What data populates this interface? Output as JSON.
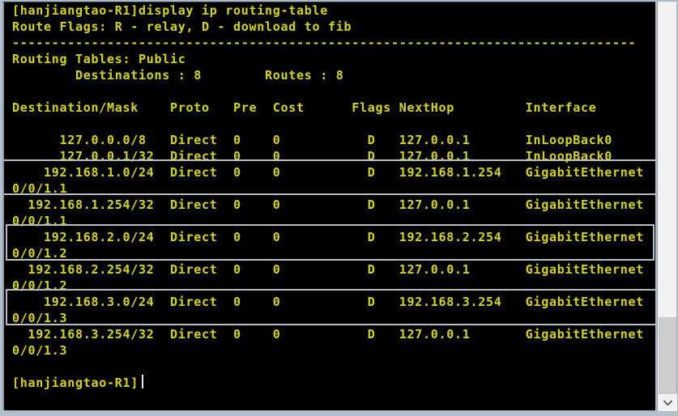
{
  "window": {
    "title": "display ip routing-table",
    "background_color": "#b3bfcb",
    "console_background": "#000000",
    "text_color": "#cccc33",
    "highlight_border_color": "#b9bcc0"
  },
  "console": {
    "prompt": "[hanjiangtao-R1]",
    "command": "display ip routing-table",
    "lines": [
      "[hanjiangtao-R1]display ip routing-table",
      "Route Flags: R - relay, D - download to fib",
      "-------------------------------------------------------------------------------",
      "Routing Tables: Public",
      "        Destinations : 8        Routes : 8",
      "",
      "Destination/Mask    Proto   Pre  Cost      Flags NextHop         Interface",
      "",
      "      127.0.0.0/8   Direct  0    0           D   127.0.0.1       InLoopBack0",
      "      127.0.0.1/32  Direct  0    0           D   127.0.0.1       InLoopBack0",
      "    192.168.1.0/24  Direct  0    0           D   192.168.1.254   GigabitEthernet",
      "0/0/1.1",
      "  192.168.1.254/32  Direct  0    0           D   127.0.0.1       GigabitEthernet",
      "0/0/1.1",
      "    192.168.2.0/24  Direct  0    0           D   192.168.2.254   GigabitEthernet",
      "0/0/1.2",
      "  192.168.2.254/32  Direct  0    0           D   127.0.0.1       GigabitEthernet",
      "0/0/1.2",
      "    192.168.3.0/24  Direct  0    0           D   192.168.3.254   GigabitEthernet",
      "0/0/1.3",
      "  192.168.3.254/32  Direct  0    0           D   127.0.0.1       GigabitEthernet",
      "0/0/1.3",
      "",
      "[hanjiangtao-R1]"
    ],
    "route_flags_legend": "Route Flags: R - relay, D - download to fib",
    "separator": "-------------------------------------------------------------------------------",
    "routing_table_name": "Routing Tables: Public",
    "destinations_label": "Destinations :",
    "destinations_count": "8",
    "routes_label": "Routes :",
    "routes_count": "8",
    "columns": [
      "Destination/Mask",
      "Proto",
      "Pre",
      "Cost",
      "Flags",
      "NextHop",
      "Interface"
    ],
    "routes": [
      {
        "destination": "127.0.0.0/8",
        "proto": "Direct",
        "pre": "0",
        "cost": "0",
        "flags": "D",
        "nexthop": "127.0.0.1",
        "interface": "InLoopBack0",
        "highlighted": false
      },
      {
        "destination": "127.0.0.1/32",
        "proto": "Direct",
        "pre": "0",
        "cost": "0",
        "flags": "D",
        "nexthop": "127.0.0.1",
        "interface": "InLoopBack0",
        "highlighted": false
      },
      {
        "destination": "192.168.1.0/24",
        "proto": "Direct",
        "pre": "0",
        "cost": "0",
        "flags": "D",
        "nexthop": "192.168.1.254",
        "interface": "GigabitEthernet0/0/1.1",
        "highlighted": true
      },
      {
        "destination": "192.168.1.254/32",
        "proto": "Direct",
        "pre": "0",
        "cost": "0",
        "flags": "D",
        "nexthop": "127.0.0.1",
        "interface": "GigabitEthernet0/0/1.1",
        "highlighted": false
      },
      {
        "destination": "192.168.2.0/24",
        "proto": "Direct",
        "pre": "0",
        "cost": "0",
        "flags": "D",
        "nexthop": "192.168.2.254",
        "interface": "GigabitEthernet0/0/1.2",
        "highlighted": true
      },
      {
        "destination": "192.168.2.254/32",
        "proto": "Direct",
        "pre": "0",
        "cost": "0",
        "flags": "D",
        "nexthop": "127.0.0.1",
        "interface": "GigabitEthernet0/0/1.2",
        "highlighted": false
      },
      {
        "destination": "192.168.3.0/24",
        "proto": "Direct",
        "pre": "0",
        "cost": "0",
        "flags": "D",
        "nexthop": "192.168.3.254",
        "interface": "GigabitEthernet0/0/1.3",
        "highlighted": true
      },
      {
        "destination": "192.168.3.254/32",
        "proto": "Direct",
        "pre": "0",
        "cost": "0",
        "flags": "D",
        "nexthop": "127.0.0.1",
        "interface": "GigabitEthernet0/0/1.3",
        "highlighted": false
      }
    ]
  },
  "scrollbar": {
    "down_arrow_icon": "chevron-down-icon",
    "orientation": "vertical"
  }
}
